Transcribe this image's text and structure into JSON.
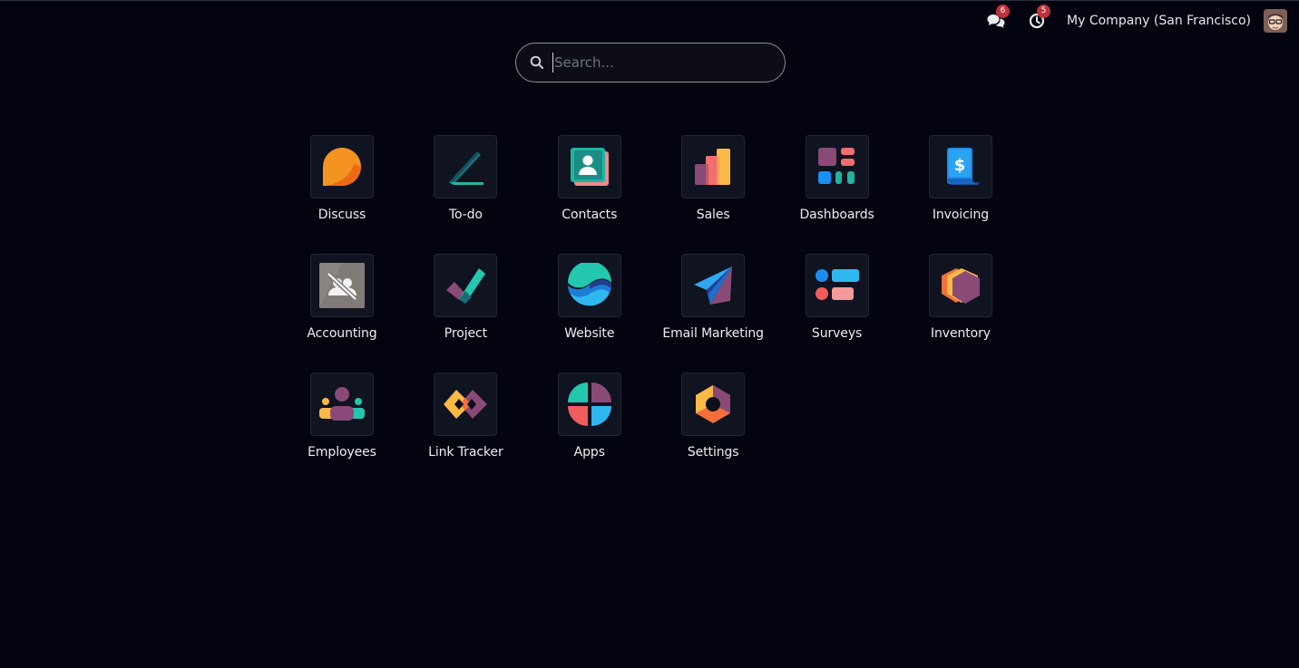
{
  "topbar": {
    "messages_badge": "6",
    "activities_badge": "5",
    "company": "My Company (San Francisco)",
    "messages_icon": "chat-bubbles-icon",
    "activities_icon": "clock-icon",
    "avatar_icon": "user-avatar"
  },
  "search": {
    "placeholder": "Search...",
    "value": ""
  },
  "apps": [
    {
      "label": "Discuss",
      "icon": "discuss-icon"
    },
    {
      "label": "To-do",
      "icon": "todo-icon"
    },
    {
      "label": "Contacts",
      "icon": "contacts-icon"
    },
    {
      "label": "Sales",
      "icon": "sales-icon"
    },
    {
      "label": "Dashboards",
      "icon": "dashboards-icon"
    },
    {
      "label": "Invoicing",
      "icon": "invoicing-icon"
    },
    {
      "label": "Accounting",
      "icon": "accounting-icon"
    },
    {
      "label": "Project",
      "icon": "project-icon"
    },
    {
      "label": "Website",
      "icon": "website-icon"
    },
    {
      "label": "Email Marketing",
      "icon": "email-marketing-icon"
    },
    {
      "label": "Surveys",
      "icon": "surveys-icon"
    },
    {
      "label": "Inventory",
      "icon": "inventory-icon"
    },
    {
      "label": "Employees",
      "icon": "employees-icon"
    },
    {
      "label": "Link Tracker",
      "icon": "link-tracker-icon"
    },
    {
      "label": "Apps",
      "icon": "apps-icon"
    },
    {
      "label": "Settings",
      "icon": "settings-icon"
    }
  ],
  "colors": {
    "background": "#03040f",
    "badge": "#c0323a",
    "tile": "#101320"
  }
}
